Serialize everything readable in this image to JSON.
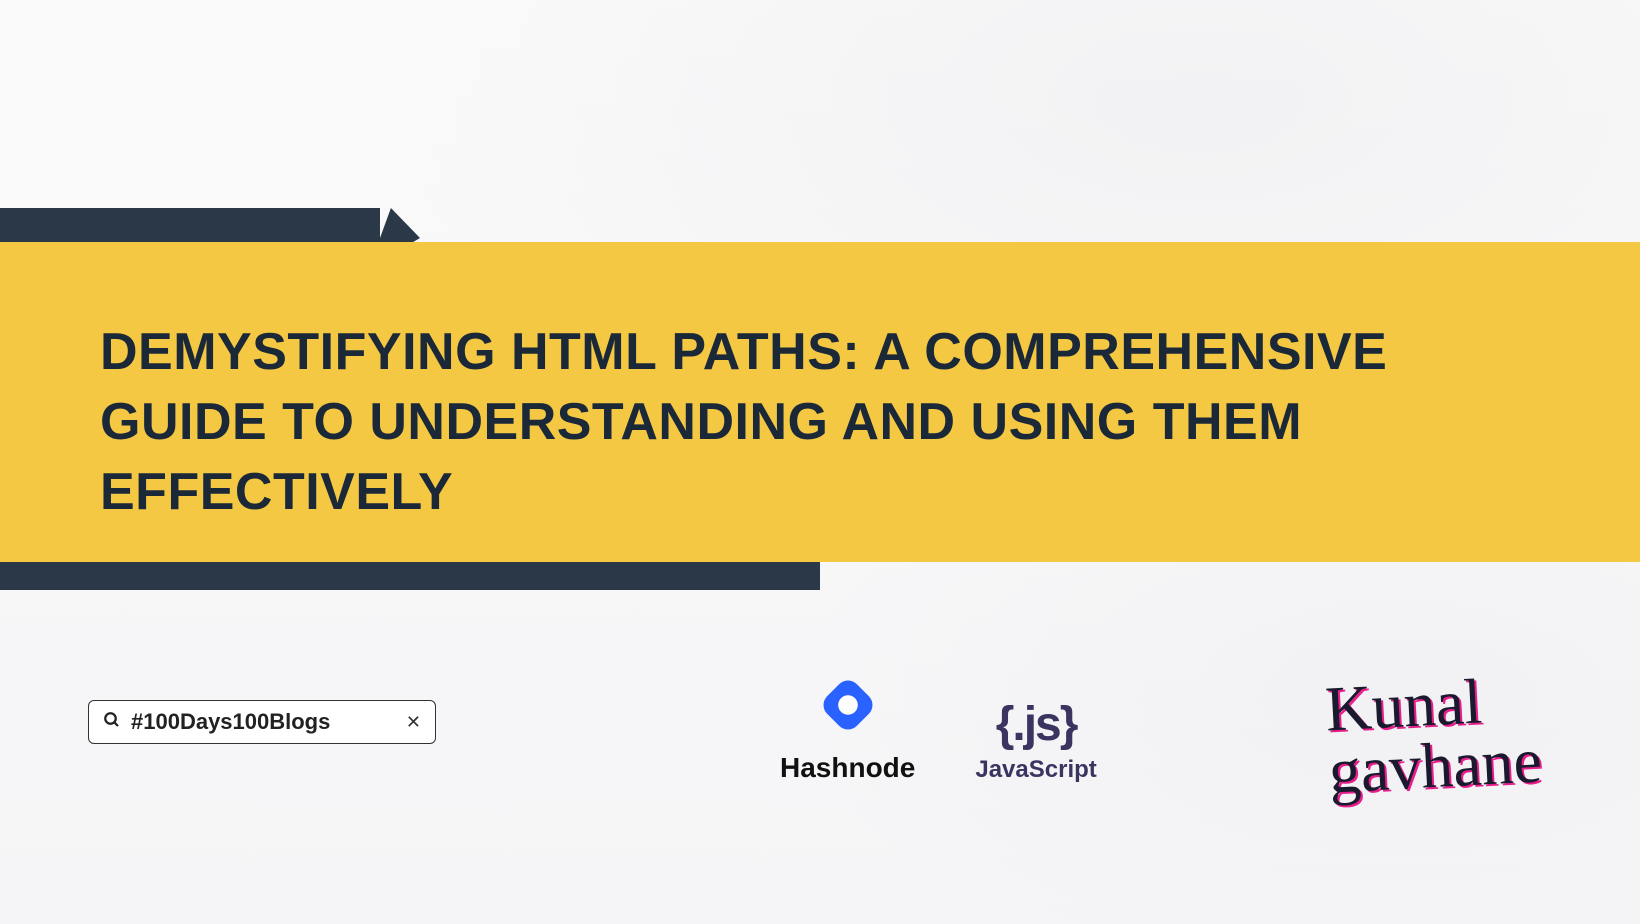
{
  "title": "DEMYSTIFYING HTML PATHS: A COMPREHENSIVE GUIDE TO UNDERSTANDING AND USING THEM EFFECTIVELY",
  "search": {
    "value": "#100Days100Blogs"
  },
  "logos": {
    "hashnode": "Hashnode",
    "js_braces": "{.js}",
    "js_text": "JavaScript"
  },
  "signature": {
    "line1": "Kunal",
    "line2": "gavhane"
  }
}
